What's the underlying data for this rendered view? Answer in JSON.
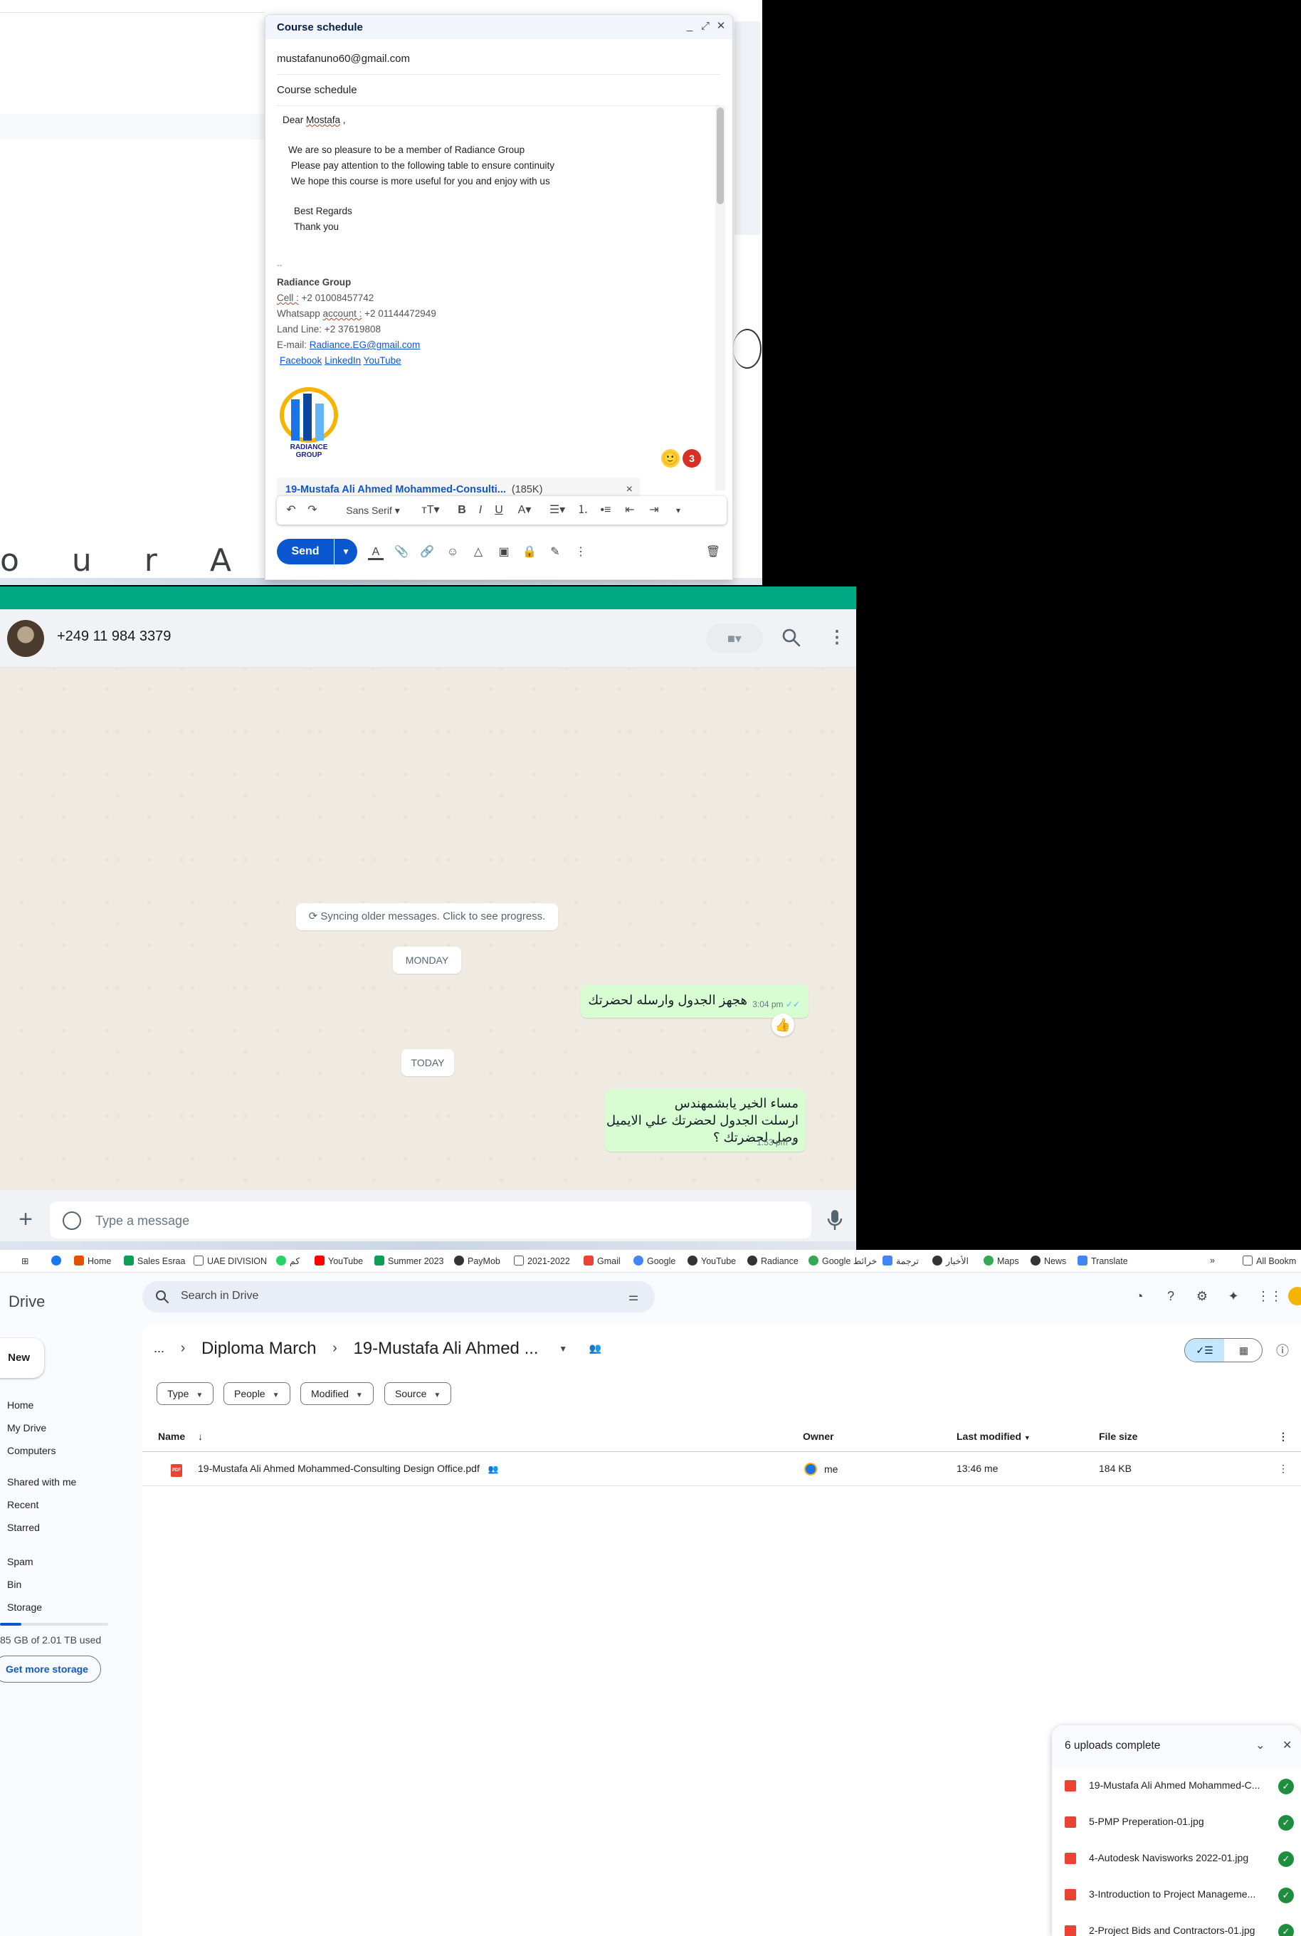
{
  "gmail": {
    "compose_title": "Course schedule",
    "to": "mustafanuno60@gmail.com",
    "subject": "Course schedule",
    "body": {
      "greeting_1": "Dear ",
      "greeting_name": "Mostafa",
      "greeting_2": " ,",
      "line1": "We are so pleasure to be a member of Radiance Group",
      "line2": "Please pay attention to the following table to ensure continuity",
      "line3": "We hope this course is more useful for you and enjoy with us",
      "regards": "Best Regards",
      "thanks": "Thank you",
      "sig_dash": "--",
      "sig_company": "Radiance Group",
      "cell_label": "Cell :",
      "cell_value": " +2 01008457742",
      "wa_label_1": "Whatsapp ",
      "wa_label_2": "account :",
      "wa_value": " +2 01144472949",
      "landline": "Land Line: +2 37619808",
      "email_label": "E-mail: ",
      "email_value": "Radiance.EG@gmail.com",
      "facebook": "Facebook",
      "linkedin": "LinkedIn",
      "youtube": "YouTube",
      "logo_text": "RADIANCE GROUP"
    },
    "attachment_name": "19-Mustafa Ali Ahmed Mohammed-Consulti...",
    "attachment_size": "(185K)",
    "emoji_badge": "3",
    "format": {
      "font": "Sans Serif"
    },
    "send_label": "Send",
    "bg_letters": "o u r   A p p l i c a"
  },
  "whatsapp": {
    "contact": "+249 11 984 3379",
    "sync_text": "Syncing older messages. Click to see progress.",
    "day1": "MONDAY",
    "msg1": "هجهز الجدول وارسله لحضرتك",
    "msg1_time": "3:04 pm",
    "reaction": "👍",
    "day2": "TODAY",
    "msg2_line1": "مساء الخير يابشمهندس",
    "msg2_line2": "ارسلت الجدول لحضرتك علي الايميل",
    "msg2_line3": "وصل لحضرتك ؟",
    "msg2_time": "1:53 pm",
    "placeholder": "Type a message"
  },
  "drive": {
    "bookmarks": [
      "Home",
      "Sales Esraa",
      "UAE DIVISION",
      "كم",
      "YouTube",
      "Summer 2023",
      "PayMob",
      "2021-2022",
      "Gmail",
      "Google",
      "YouTube",
      "Radiance",
      "Google خرائط",
      "ترجمة",
      "الأخبار",
      "Maps",
      "News",
      "Translate"
    ],
    "all_bookmarks": "All Bookm",
    "brand": "Drive",
    "search_placeholder": "Search in Drive",
    "new_label": "New",
    "nav": [
      "Home",
      "My Drive",
      "Computers",
      "Shared with me",
      "Recent",
      "Starred",
      "Spam",
      "Bin",
      "Storage"
    ],
    "storage_text": "85 GB of 2.01 TB used",
    "get_more": "Get more storage",
    "breadcrumb": {
      "ellipsis": "...",
      "parent": "Diploma March",
      "current": "19-Mustafa Ali Ahmed ..."
    },
    "chips": [
      "Type",
      "People",
      "Modified",
      "Source"
    ],
    "columns": {
      "name": "Name",
      "owner": "Owner",
      "last_modified": "Last modified",
      "file_size": "File size"
    },
    "file": {
      "name": "19-Mustafa Ali Ahmed Mohammed-Consulting Design Office.pdf",
      "owner": "me",
      "modified": "13:46 me",
      "size": "184 KB"
    },
    "uploads": {
      "title": "6 uploads complete",
      "items": [
        "19-Mustafa Ali Ahmed Mohammed-C...",
        "5-PMP Preperation-01.jpg",
        "4-Autodesk Navisworks 2022-01.jpg",
        "3-Introduction to Project Manageme...",
        "2-Project Bids and Contractors-01.jpg"
      ]
    }
  }
}
